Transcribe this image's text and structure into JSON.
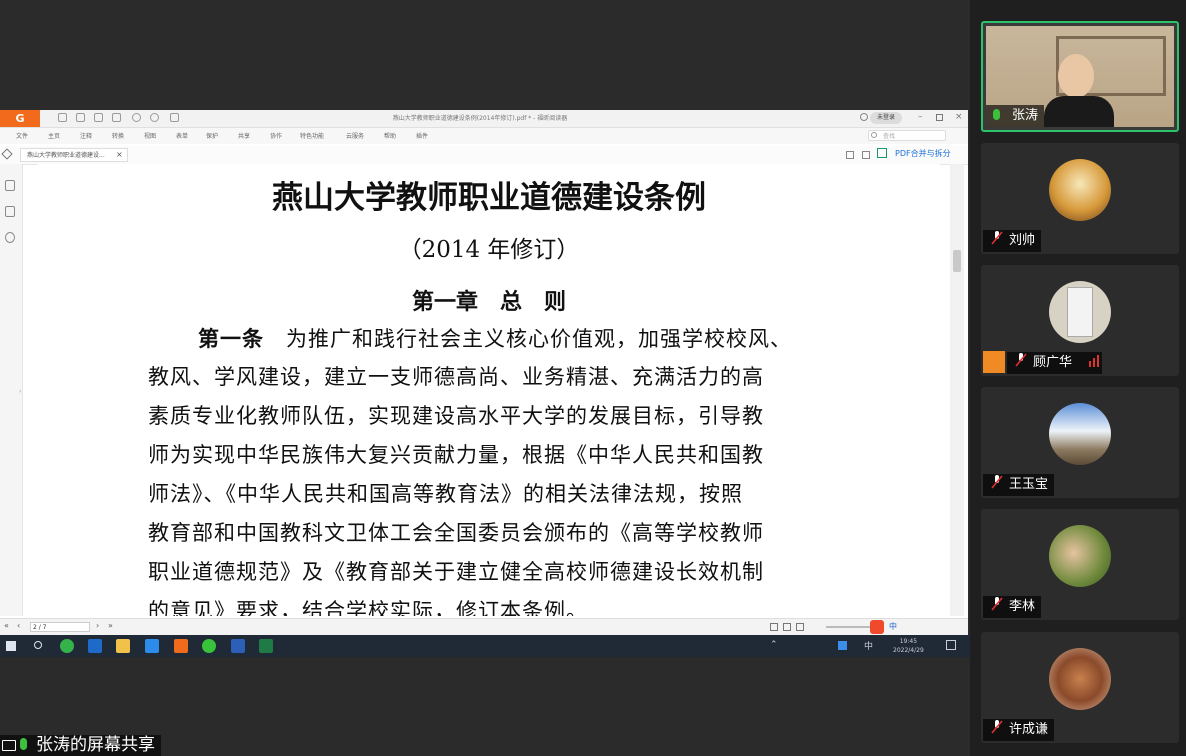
{
  "pdf_viewer": {
    "app_logo": "G",
    "document_title": "燕山大学教师职业道德建设条例(2014年修订).pdf * - 福昕阅读器",
    "reading_mode": "未登录",
    "menu": [
      "文件",
      "主页",
      "注释",
      "转换",
      "视图",
      "表单",
      "保护",
      "共享",
      "协作",
      "特色功能",
      "云服务",
      "帮助",
      "插件"
    ],
    "search_placeholder": "查找",
    "tab_label": "燕山大学教师职业道德建设...",
    "pdf_merge_label": "PDF合并与拆分",
    "page_indicator": "2 / 7",
    "document": {
      "title": "燕山大学教师职业道德建设条例",
      "subtitle": "（2014 年修订）",
      "chapter": "第一章　总　则",
      "article_label": "第一条",
      "lines": [
        "为推广和践行社会主义核心价值观，加强学校校风、",
        "教风、学风建设，建立一支师德高尚、业务精湛、充满活力的高",
        "素质专业化教师队伍，实现建设高水平大学的发展目标，引导教",
        "师为实现中华民族伟大复兴贡献力量，根据《中华人民共和国教",
        "师法》、《中华人民共和国高等教育法》的相关法律法规，按照",
        "教育部和中国教科文卫体工会全国委员会颁布的《高等学校教师",
        "职业道德规范》及《教育部关于建立健全高校师德建设长效机制",
        "的意见》要求，结合学校实际，修订本条例。"
      ]
    }
  },
  "taskbar": {
    "time": "19:45",
    "date": "2022/4/29",
    "ime": "中"
  },
  "share_label": "张涛的屏幕共享",
  "participants": [
    {
      "name": "张涛",
      "mic": "on",
      "active": true
    },
    {
      "name": "刘帅",
      "mic": "muted"
    },
    {
      "name": "顾广华",
      "mic": "muted",
      "signal": "strong"
    },
    {
      "name": "王玉宝",
      "mic": "muted"
    },
    {
      "name": "李林",
      "mic": "muted"
    },
    {
      "name": "许成谦",
      "mic": "muted"
    }
  ],
  "colors": {
    "active_border": "#2cc36b",
    "app_accent": "#f26b1d",
    "mute_red": "#e03030"
  }
}
